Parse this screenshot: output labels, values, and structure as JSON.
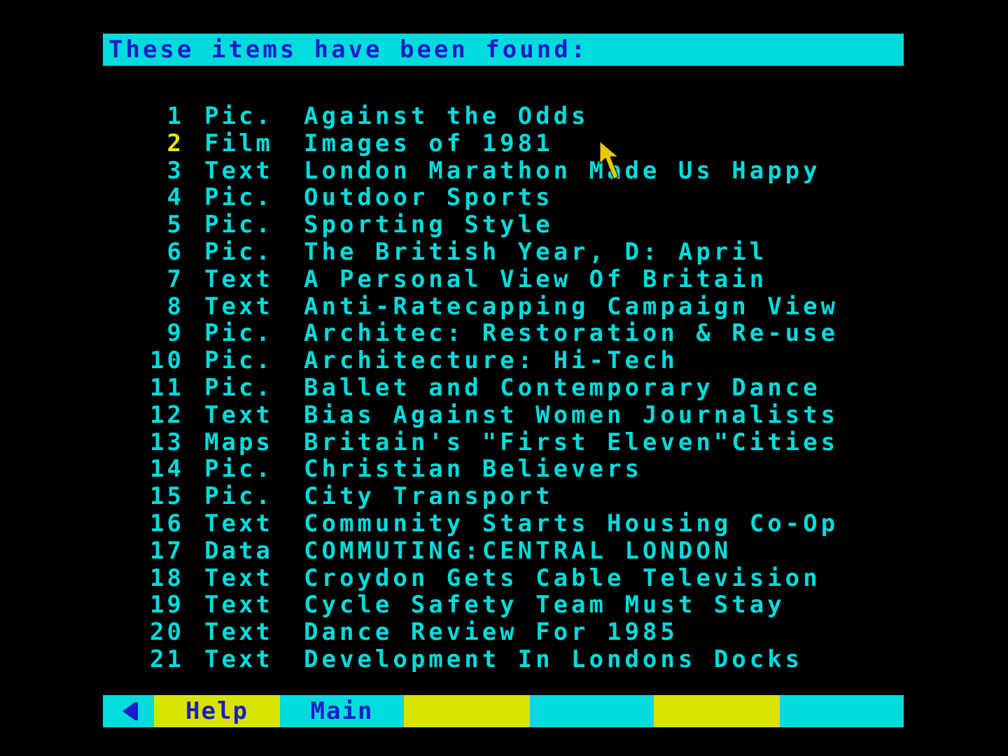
{
  "header": {
    "title": "These items have been found:"
  },
  "results": [
    {
      "num": "1",
      "type": "Pic.",
      "title": "Against the Odds"
    },
    {
      "num": "2",
      "type": "Film",
      "title": "Images of 1981"
    },
    {
      "num": "3",
      "type": "Text",
      "title": "London Marathon Made Us Happy"
    },
    {
      "num": "4",
      "type": "Pic.",
      "title": "Outdoor Sports"
    },
    {
      "num": "5",
      "type": "Pic.",
      "title": "Sporting Style"
    },
    {
      "num": "6",
      "type": "Pic.",
      "title": "The British Year, D: April"
    },
    {
      "num": "7",
      "type": "Text",
      "title": "A Personal View Of Britain"
    },
    {
      "num": "8",
      "type": "Text",
      "title": "Anti-Ratecapping Campaign View"
    },
    {
      "num": "9",
      "type": "Pic.",
      "title": "Architec: Restoration & Re-use"
    },
    {
      "num": "10",
      "type": "Pic.",
      "title": "Architecture: Hi-Tech"
    },
    {
      "num": "11",
      "type": "Pic.",
      "title": "Ballet and Contemporary Dance"
    },
    {
      "num": "12",
      "type": "Text",
      "title": "Bias Against Women Journalists"
    },
    {
      "num": "13",
      "type": "Maps",
      "title": "Britain's \"First Eleven\"Cities"
    },
    {
      "num": "14",
      "type": "Pic.",
      "title": "Christian Believers"
    },
    {
      "num": "15",
      "type": "Pic.",
      "title": "City Transport"
    },
    {
      "num": "16",
      "type": "Text",
      "title": "Community Starts Housing Co-Op"
    },
    {
      "num": "17",
      "type": "Data",
      "title": "COMMUTING:CENTRAL LONDON"
    },
    {
      "num": "18",
      "type": "Text",
      "title": "Croydon Gets Cable Television"
    },
    {
      "num": "19",
      "type": "Text",
      "title": "Cycle Safety Team Must Stay"
    },
    {
      "num": "20",
      "type": "Text",
      "title": "Dance Review For 1985"
    },
    {
      "num": "21",
      "type": "Text",
      "title": "Development In Londons Docks"
    }
  ],
  "highlighted_index": 1,
  "footer": {
    "back_icon": "left-arrow-icon",
    "help_label": "Help",
    "main_label": "Main"
  },
  "colors": {
    "background": "#000000",
    "cyan": "#00dcdc",
    "yellow": "#d8e400",
    "blue_text": "#1c1cc8",
    "highlight_number": "#e8e800"
  }
}
